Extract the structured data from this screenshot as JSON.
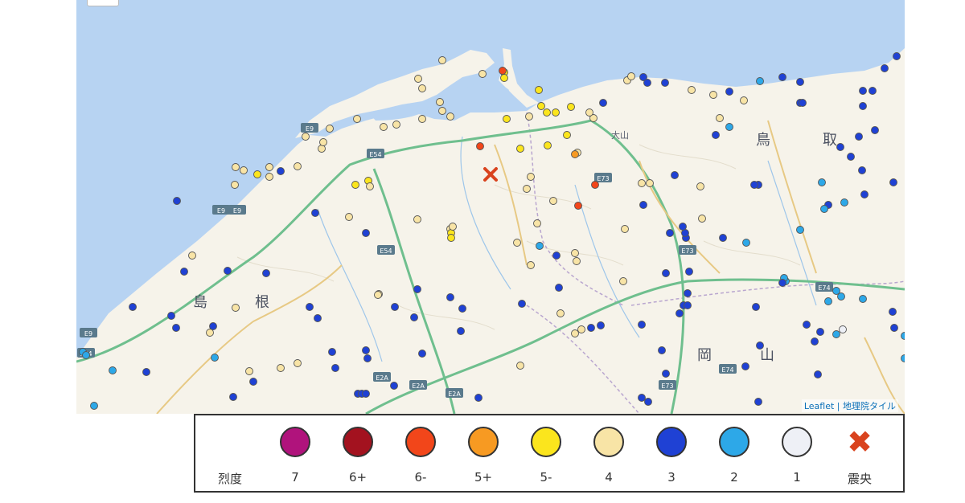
{
  "map": {
    "attribution_leaflet": "Leaflet",
    "attribution_sep": " | ",
    "attribution_tiles": "地理院タイル",
    "place_labels": [
      {
        "id": "shimane-1",
        "text": "島"
      },
      {
        "id": "shimane-2",
        "text": "根"
      },
      {
        "id": "tottori-1",
        "text": "鳥"
      },
      {
        "id": "tottori-2",
        "text": "取"
      },
      {
        "id": "okayama-1",
        "text": "岡"
      },
      {
        "id": "okayama-2",
        "text": "山"
      },
      {
        "id": "daisen",
        "text": "大山"
      }
    ],
    "road_labels": [
      "E9",
      "E9",
      "E54",
      "E54",
      "E73",
      "E73",
      "E73",
      "E74",
      "E74",
      "E74",
      "E2A",
      "E2A",
      "E2A",
      "E9",
      "E9"
    ]
  },
  "legend": {
    "title": "烈度",
    "items": [
      {
        "label": "7",
        "color": "#b0137c"
      },
      {
        "label": "6+",
        "color": "#a3121f"
      },
      {
        "label": "6-",
        "color": "#f2461a"
      },
      {
        "label": "5+",
        "color": "#f79a22"
      },
      {
        "label": "5-",
        "color": "#fbe51d"
      },
      {
        "label": "4",
        "color": "#f8e4a6"
      },
      {
        "label": "3",
        "color": "#1f41d4"
      },
      {
        "label": "2",
        "color": "#2da8e8"
      },
      {
        "label": "1",
        "color": "#eef0f6"
      }
    ],
    "epicenter_label": "震央",
    "epicenter_icon": "x-mark-icon",
    "epicenter_color": "#d9431e"
  }
}
